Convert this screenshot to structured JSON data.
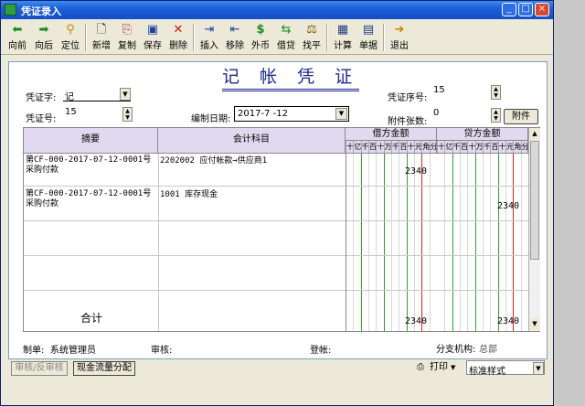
{
  "window": {
    "title": "凭证录入",
    "min": "_",
    "max": "□",
    "close": "×"
  },
  "toolbar": [
    {
      "label": "向前",
      "icon": "arrow-left-icon",
      "glyph": "⬅"
    },
    {
      "label": "向后",
      "icon": "arrow-right-icon",
      "glyph": "➡"
    },
    {
      "label": "定位",
      "icon": "locate-icon",
      "glyph": "⚲"
    },
    {
      "label": "新增",
      "icon": "new-doc-icon",
      "glyph": "🗋"
    },
    {
      "label": "复制",
      "icon": "copy-icon",
      "glyph": "⎘"
    },
    {
      "label": "保存",
      "icon": "save-icon",
      "glyph": "▣"
    },
    {
      "label": "删除",
      "icon": "delete-icon",
      "glyph": "✕"
    },
    {
      "label": "插入",
      "icon": "insert-icon",
      "glyph": "⇥"
    },
    {
      "label": "移除",
      "icon": "remove-icon",
      "glyph": "⇤"
    },
    {
      "label": "外币",
      "icon": "currency-icon",
      "glyph": "$"
    },
    {
      "label": "借贷",
      "icon": "debit-credit-icon",
      "glyph": "⇆"
    },
    {
      "label": "找平",
      "icon": "balance-icon",
      "glyph": "⚖"
    },
    {
      "label": "计算",
      "icon": "calculator-icon",
      "glyph": "▦"
    },
    {
      "label": "单据",
      "icon": "document-icon",
      "glyph": "▤"
    },
    {
      "label": "退出",
      "icon": "exit-icon",
      "glyph": "➜"
    }
  ],
  "voucher": {
    "title": "记 帐 凭 证",
    "word_label": "凭证字:",
    "word_value": "记",
    "no_label": "凭证号:",
    "no_value": "15",
    "date_label": "编制日期:",
    "date_value": "2017-7 -12",
    "seq_label": "凭证序号:",
    "seq_value": "15",
    "attach_label": "附件张数:",
    "attach_value": "0",
    "attach_button": "附件"
  },
  "grid": {
    "col_summary": "摘要",
    "col_account": "会计科目",
    "col_debit": "借方金额",
    "col_credit": "贷方金额",
    "digit_headers": [
      "十",
      "亿",
      "千",
      "百",
      "十",
      "万",
      "千",
      "百",
      "十",
      "元",
      "角",
      "分"
    ],
    "rows": [
      {
        "summary": "第CF-000-2017-07-12-0001号采购付款",
        "account": "2202002 应付帐款→供应商1",
        "debit": "2340",
        "credit": ""
      },
      {
        "summary": "第CF-000-2017-07-12-0001号采购付款",
        "account": "1001 库存现金",
        "debit": "",
        "credit": "2340"
      }
    ],
    "total_label": "合计",
    "total_debit": "2340",
    "total_credit": "2340"
  },
  "footer": {
    "maker_label": "制单:",
    "maker_value": "系统管理员",
    "audit_label": "审核:",
    "post_label": "登帐:",
    "branch_label": "分支机构:",
    "branch_value": "总部"
  },
  "bottom": {
    "audit_toggle": "审核/反审核",
    "cashflow": "现金流量分配",
    "print": "打印",
    "print_style": "标准样式"
  }
}
